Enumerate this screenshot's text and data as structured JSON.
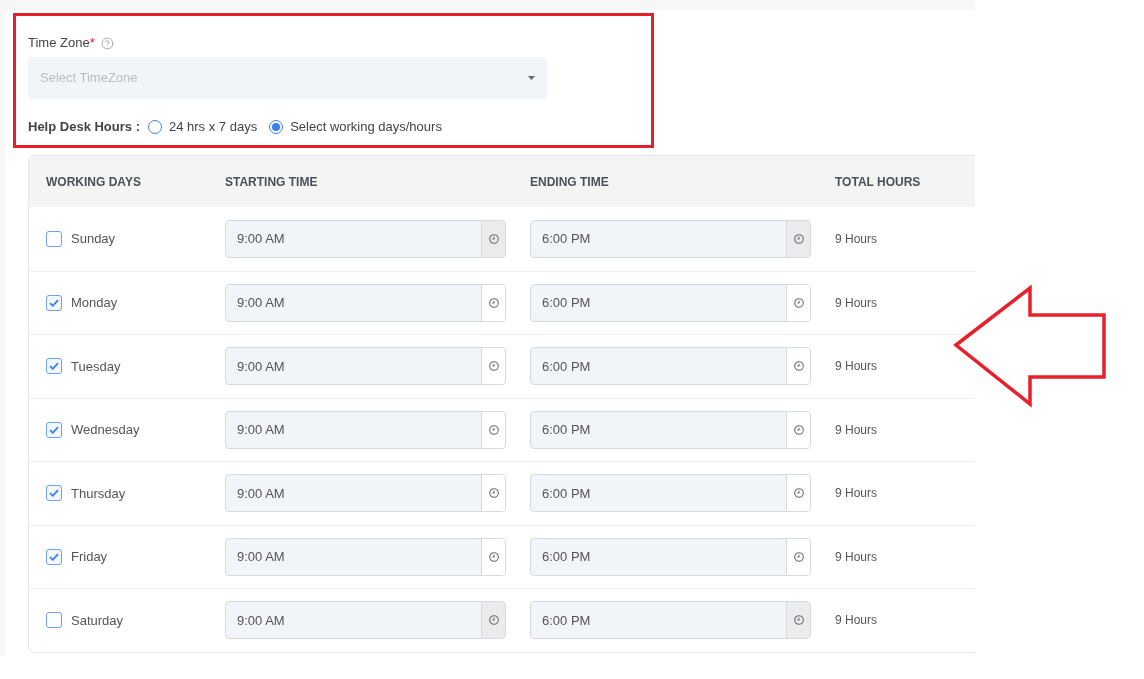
{
  "time_zone": {
    "label": "Time Zone",
    "required_mark": "*",
    "placeholder": "Select TimeZone"
  },
  "help_desk_hours": {
    "label": "Help Desk Hours :",
    "options": [
      {
        "label": "24 hrs x 7 days",
        "selected": false
      },
      {
        "label": "Select working days/hours",
        "selected": true
      }
    ]
  },
  "table": {
    "columns": [
      "WORKING DAYS",
      "STARTING TIME",
      "ENDING TIME",
      "TOTAL HOURS"
    ],
    "rows": [
      {
        "day": "Sunday",
        "checked": false,
        "start": "9:00 AM",
        "end": "6:00 PM",
        "total": "9 Hours"
      },
      {
        "day": "Monday",
        "checked": true,
        "start": "9:00 AM",
        "end": "6:00 PM",
        "total": "9 Hours"
      },
      {
        "day": "Tuesday",
        "checked": true,
        "start": "9:00 AM",
        "end": "6:00 PM",
        "total": "9 Hours"
      },
      {
        "day": "Wednesday",
        "checked": true,
        "start": "9:00 AM",
        "end": "6:00 PM",
        "total": "9 Hours"
      },
      {
        "day": "Thursday",
        "checked": true,
        "start": "9:00 AM",
        "end": "6:00 PM",
        "total": "9 Hours"
      },
      {
        "day": "Friday",
        "checked": true,
        "start": "9:00 AM",
        "end": "6:00 PM",
        "total": "9 Hours"
      },
      {
        "day": "Saturday",
        "checked": false,
        "start": "9:00 AM",
        "end": "6:00 PM",
        "total": "9 Hours"
      }
    ]
  }
}
